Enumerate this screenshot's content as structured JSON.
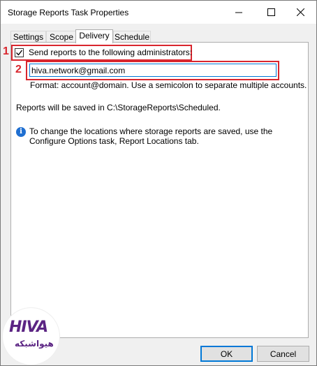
{
  "window": {
    "title": "Storage Reports Task Properties"
  },
  "tabs": [
    {
      "label": "Settings",
      "active": false
    },
    {
      "label": "Scope",
      "active": false
    },
    {
      "label": "Delivery",
      "active": true
    },
    {
      "label": "Schedule",
      "active": false
    }
  ],
  "markers": {
    "one": "1",
    "two": "2"
  },
  "delivery": {
    "send_checkbox_label": "Send reports to the following administrators:",
    "send_checked": true,
    "email_value": "hiva.network@gmail.com",
    "format_hint": "Format: account@domain. Use a semicolon to separate multiple accounts.",
    "saved_location": "Reports will be saved in C:\\StorageReports\\Scheduled.",
    "info_text": "To change the locations where storage reports are saved, use the Configure Options task, Report Locations tab."
  },
  "logo": {
    "main": "HIVA",
    "sub": "هیواشبکه"
  },
  "buttons": {
    "ok": "OK",
    "cancel": "Cancel"
  },
  "colors": {
    "highlight_red": "#d9262e",
    "accent_blue": "#0078d7",
    "logo_purple": "#5b2483"
  }
}
